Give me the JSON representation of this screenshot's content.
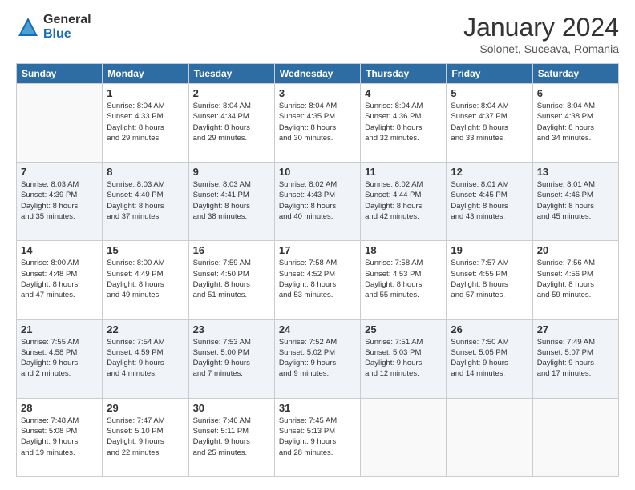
{
  "header": {
    "logo_general": "General",
    "logo_blue": "Blue",
    "month_title": "January 2024",
    "subtitle": "Solonet, Suceava, Romania"
  },
  "weekdays": [
    "Sunday",
    "Monday",
    "Tuesday",
    "Wednesday",
    "Thursday",
    "Friday",
    "Saturday"
  ],
  "weeks": [
    [
      {
        "day": "",
        "info": ""
      },
      {
        "day": "1",
        "info": "Sunrise: 8:04 AM\nSunset: 4:33 PM\nDaylight: 8 hours\nand 29 minutes."
      },
      {
        "day": "2",
        "info": "Sunrise: 8:04 AM\nSunset: 4:34 PM\nDaylight: 8 hours\nand 29 minutes."
      },
      {
        "day": "3",
        "info": "Sunrise: 8:04 AM\nSunset: 4:35 PM\nDaylight: 8 hours\nand 30 minutes."
      },
      {
        "day": "4",
        "info": "Sunrise: 8:04 AM\nSunset: 4:36 PM\nDaylight: 8 hours\nand 32 minutes."
      },
      {
        "day": "5",
        "info": "Sunrise: 8:04 AM\nSunset: 4:37 PM\nDaylight: 8 hours\nand 33 minutes."
      },
      {
        "day": "6",
        "info": "Sunrise: 8:04 AM\nSunset: 4:38 PM\nDaylight: 8 hours\nand 34 minutes."
      }
    ],
    [
      {
        "day": "7",
        "info": "Sunrise: 8:03 AM\nSunset: 4:39 PM\nDaylight: 8 hours\nand 35 minutes."
      },
      {
        "day": "8",
        "info": "Sunrise: 8:03 AM\nSunset: 4:40 PM\nDaylight: 8 hours\nand 37 minutes."
      },
      {
        "day": "9",
        "info": "Sunrise: 8:03 AM\nSunset: 4:41 PM\nDaylight: 8 hours\nand 38 minutes."
      },
      {
        "day": "10",
        "info": "Sunrise: 8:02 AM\nSunset: 4:43 PM\nDaylight: 8 hours\nand 40 minutes."
      },
      {
        "day": "11",
        "info": "Sunrise: 8:02 AM\nSunset: 4:44 PM\nDaylight: 8 hours\nand 42 minutes."
      },
      {
        "day": "12",
        "info": "Sunrise: 8:01 AM\nSunset: 4:45 PM\nDaylight: 8 hours\nand 43 minutes."
      },
      {
        "day": "13",
        "info": "Sunrise: 8:01 AM\nSunset: 4:46 PM\nDaylight: 8 hours\nand 45 minutes."
      }
    ],
    [
      {
        "day": "14",
        "info": "Sunrise: 8:00 AM\nSunset: 4:48 PM\nDaylight: 8 hours\nand 47 minutes."
      },
      {
        "day": "15",
        "info": "Sunrise: 8:00 AM\nSunset: 4:49 PM\nDaylight: 8 hours\nand 49 minutes."
      },
      {
        "day": "16",
        "info": "Sunrise: 7:59 AM\nSunset: 4:50 PM\nDaylight: 8 hours\nand 51 minutes."
      },
      {
        "day": "17",
        "info": "Sunrise: 7:58 AM\nSunset: 4:52 PM\nDaylight: 8 hours\nand 53 minutes."
      },
      {
        "day": "18",
        "info": "Sunrise: 7:58 AM\nSunset: 4:53 PM\nDaylight: 8 hours\nand 55 minutes."
      },
      {
        "day": "19",
        "info": "Sunrise: 7:57 AM\nSunset: 4:55 PM\nDaylight: 8 hours\nand 57 minutes."
      },
      {
        "day": "20",
        "info": "Sunrise: 7:56 AM\nSunset: 4:56 PM\nDaylight: 8 hours\nand 59 minutes."
      }
    ],
    [
      {
        "day": "21",
        "info": "Sunrise: 7:55 AM\nSunset: 4:58 PM\nDaylight: 9 hours\nand 2 minutes."
      },
      {
        "day": "22",
        "info": "Sunrise: 7:54 AM\nSunset: 4:59 PM\nDaylight: 9 hours\nand 4 minutes."
      },
      {
        "day": "23",
        "info": "Sunrise: 7:53 AM\nSunset: 5:00 PM\nDaylight: 9 hours\nand 7 minutes."
      },
      {
        "day": "24",
        "info": "Sunrise: 7:52 AM\nSunset: 5:02 PM\nDaylight: 9 hours\nand 9 minutes."
      },
      {
        "day": "25",
        "info": "Sunrise: 7:51 AM\nSunset: 5:03 PM\nDaylight: 9 hours\nand 12 minutes."
      },
      {
        "day": "26",
        "info": "Sunrise: 7:50 AM\nSunset: 5:05 PM\nDaylight: 9 hours\nand 14 minutes."
      },
      {
        "day": "27",
        "info": "Sunrise: 7:49 AM\nSunset: 5:07 PM\nDaylight: 9 hours\nand 17 minutes."
      }
    ],
    [
      {
        "day": "28",
        "info": "Sunrise: 7:48 AM\nSunset: 5:08 PM\nDaylight: 9 hours\nand 19 minutes."
      },
      {
        "day": "29",
        "info": "Sunrise: 7:47 AM\nSunset: 5:10 PM\nDaylight: 9 hours\nand 22 minutes."
      },
      {
        "day": "30",
        "info": "Sunrise: 7:46 AM\nSunset: 5:11 PM\nDaylight: 9 hours\nand 25 minutes."
      },
      {
        "day": "31",
        "info": "Sunrise: 7:45 AM\nSunset: 5:13 PM\nDaylight: 9 hours\nand 28 minutes."
      },
      {
        "day": "",
        "info": ""
      },
      {
        "day": "",
        "info": ""
      },
      {
        "day": "",
        "info": ""
      }
    ]
  ]
}
